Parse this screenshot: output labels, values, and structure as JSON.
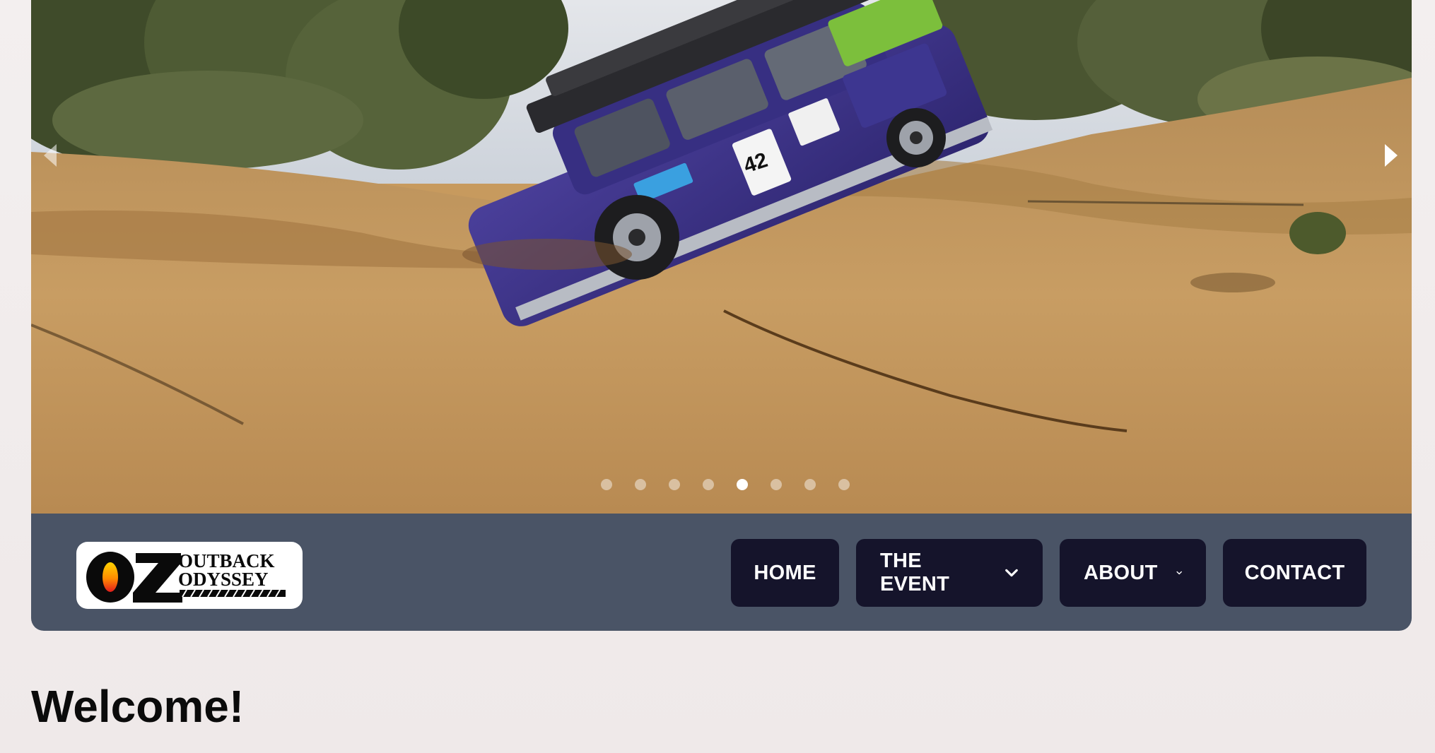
{
  "hero": {
    "prev_icon": "caret-left-icon",
    "next_icon": "caret-right-icon",
    "slide_count": 8,
    "active_slide": 5,
    "car_number": "42"
  },
  "logo": {
    "oz": "OZ",
    "line1": "OUTBACK",
    "line2": "ODYSSEY"
  },
  "nav": {
    "home": "HOME",
    "event": "THE EVENT",
    "about": "ABOUT",
    "contact": "CONTACT",
    "dropdown_icon": "chevron-down-icon"
  },
  "colors": {
    "navbar_bg": "#4a5466",
    "button_bg": "#15142b",
    "button_text": "#ffffff",
    "page_bg": "#f1ecec"
  },
  "main": {
    "heading": "Welcome!"
  }
}
